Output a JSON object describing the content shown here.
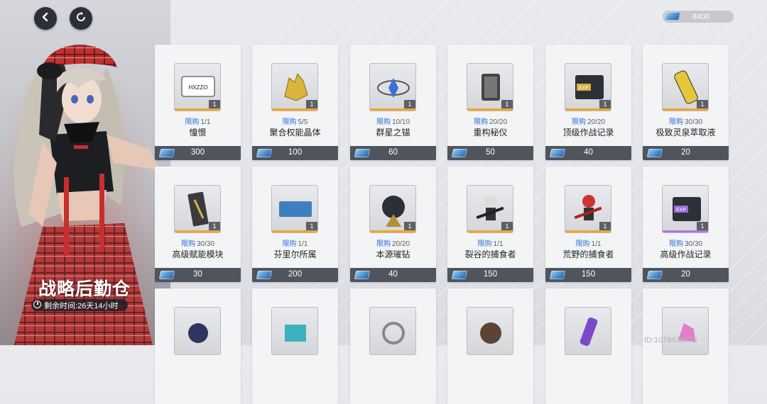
{
  "header": {
    "back_icon": "back-arrow-icon",
    "refresh_icon": "refresh-icon",
    "currency": {
      "icon": "blue-chip-currency-icon",
      "amount": "8400"
    }
  },
  "shop": {
    "title": "战略后勤仓",
    "remaining_time": "剩余时间:26天14小时"
  },
  "colors": {
    "limit_blue": "#2b6ed2",
    "bar_orange": "#f3a42a",
    "bar_purple": "#b275e3",
    "price_bar": "#50545c"
  },
  "items": [
    {
      "name": "憧憬",
      "limit_label": "限购",
      "limit": "1/1",
      "qty": "1",
      "price": "300",
      "rarity_bar": "#f3a42a",
      "icon": "tag-card-icon",
      "badge_text": "HXZZO"
    },
    {
      "name": "聚合权能晶体",
      "limit_label": "限购",
      "limit": "5/5",
      "qty": "1",
      "price": "100",
      "rarity_bar": "#f3a42a",
      "icon": "gold-crystal-icon"
    },
    {
      "name": "群星之锚",
      "limit_label": "限购",
      "limit": "10/10",
      "qty": "1",
      "price": "60",
      "rarity_bar": "#f3a42a",
      "icon": "star-anchor-icon"
    },
    {
      "name": "重构秘仪",
      "limit_label": "限购",
      "limit": "20/20",
      "qty": "1",
      "price": "50",
      "rarity_bar": "#f3a42a",
      "icon": "device-icon"
    },
    {
      "name": "顶级作战记录",
      "limit_label": "限购",
      "limit": "20/20",
      "qty": "1",
      "price": "40",
      "rarity_bar": "#f3a42a",
      "icon": "exp-record-gold-icon",
      "badge_text": "EXP"
    },
    {
      "name": "极致灵泉萃取液",
      "limit_label": "限购",
      "limit": "30/30",
      "qty": "1",
      "price": "20",
      "rarity_bar": "#f3a42a",
      "icon": "gold-vial-icon"
    },
    {
      "name": "高级赋能模块",
      "limit_label": "限购",
      "limit": "30/30",
      "qty": "1",
      "price": "30",
      "rarity_bar": "#f3a42a",
      "icon": "module-icon"
    },
    {
      "name": "芬里尔所属",
      "limit_label": "限购",
      "limit": "1/1",
      "qty": "1",
      "price": "200",
      "rarity_bar": "#f3a42a",
      "icon": "blue-card-icon"
    },
    {
      "name": "本源璀钻",
      "limit_label": "限购",
      "limit": "20/20",
      "qty": "1",
      "price": "40",
      "rarity_bar": "#f3a42a",
      "icon": "diamond-orb-icon"
    },
    {
      "name": "裂谷的捕食者",
      "limit_label": "限购",
      "limit": "1/1",
      "qty": "1",
      "price": "150",
      "rarity_bar": "#f3a42a",
      "icon": "chibi-figure-icon"
    },
    {
      "name": "荒野的捕食者",
      "limit_label": "限购",
      "limit": "1/1",
      "qty": "1",
      "price": "150",
      "rarity_bar": "#f3a42a",
      "icon": "chibi-figure-red-icon"
    },
    {
      "name": "高级作战记录",
      "limit_label": "限购",
      "limit": "30/30",
      "qty": "1",
      "price": "20",
      "rarity_bar": "#b275e3",
      "icon": "exp-record-purple-icon",
      "badge_text": "EXP"
    },
    {
      "icon": "dark-orb-icon"
    },
    {
      "icon": "cyan-crystal-icon"
    },
    {
      "icon": "silver-ring-icon"
    },
    {
      "icon": "bronze-emblem-icon"
    },
    {
      "icon": "purple-vial-icon"
    },
    {
      "icon": "pink-crystal-icon"
    }
  ],
  "footer": {
    "uid": "ID:1079438872"
  }
}
